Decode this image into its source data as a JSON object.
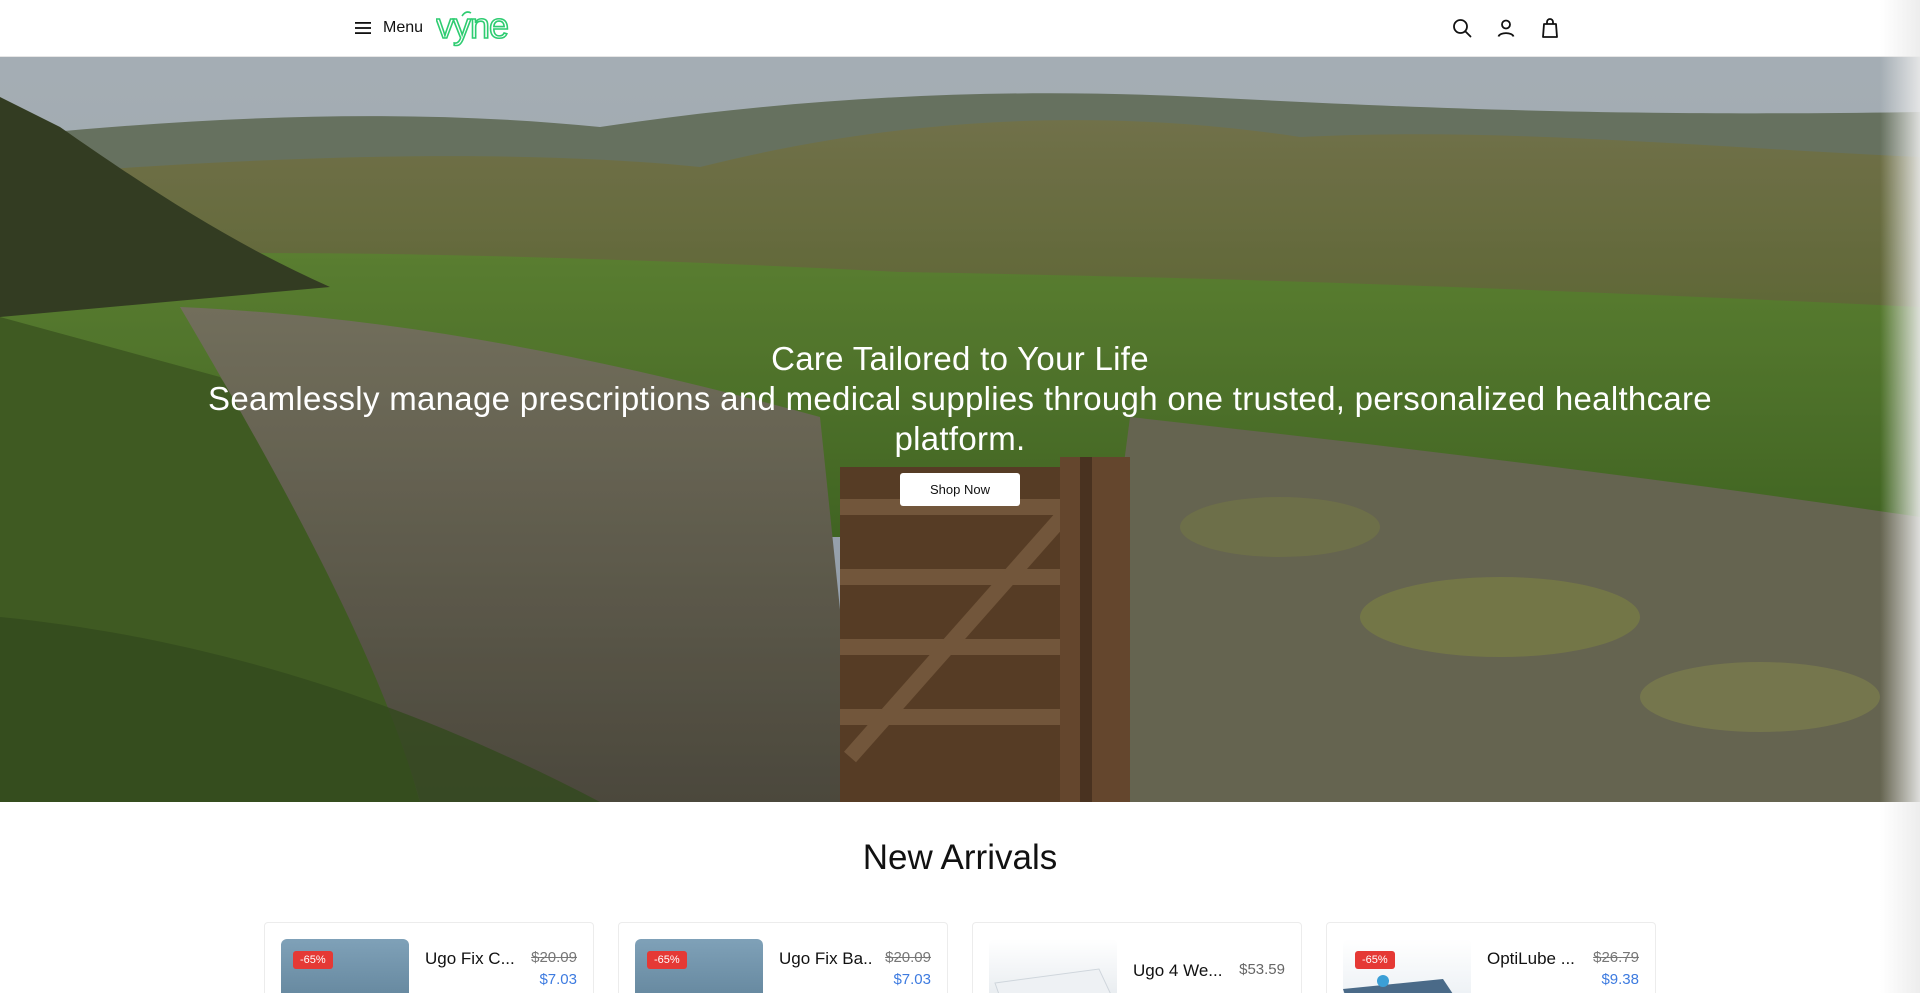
{
  "header": {
    "menu_label": "Menu",
    "logo_text": "vyne",
    "brand_color": "#2ecc71",
    "icons": [
      "search-icon",
      "account-icon",
      "bag-icon"
    ]
  },
  "hero": {
    "title": "Care Tailored to Your Life",
    "subtitle": "Seamlessly manage prescriptions and medical supplies through one trusted, personalized healthcare platform.",
    "cta_label": "Shop Now"
  },
  "new_arrivals": {
    "title": "New Arrivals",
    "products": [
      {
        "name": "Ugo Fix C...",
        "badge": "-65%",
        "price_old": "$20.09",
        "price_new": "$7.03"
      },
      {
        "name": "Ugo Fix Ba...",
        "badge": "-65%",
        "price_old": "$20.09",
        "price_new": "$7.03"
      },
      {
        "name": "Ugo 4 We...",
        "badge": "",
        "price": "$53.59"
      },
      {
        "name": "OptiLube ...",
        "badge": "-65%",
        "price_old": "$26.79",
        "price_new": "$9.38"
      }
    ]
  }
}
